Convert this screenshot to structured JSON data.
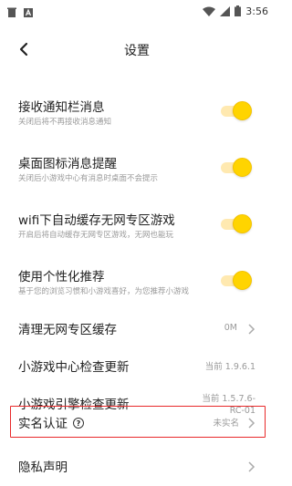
{
  "status_bar": {
    "time": "3:56",
    "left_icons": [
      "notification-trash-icon",
      "app-a-icon"
    ],
    "right_icons": [
      "wifi-icon",
      "signal-icon",
      "battery-icon"
    ]
  },
  "header": {
    "title": "设置",
    "back_icon": "chevron-left-icon"
  },
  "accent_color": "#ffd400",
  "highlight_color": "#e8292a",
  "settings": {
    "notification": {
      "title": "接收通知栏消息",
      "desc": "关闭后将不再接收消息通知",
      "enabled": true
    },
    "desktop_badge": {
      "title": "桌面图标消息提醒",
      "desc": "关闭后小游戏中心有消息时桌面不会提示",
      "enabled": true
    },
    "wifi_cache": {
      "title": "wifi下自动缓存无网专区游戏",
      "desc": "开启后将自动缓存无网专区游戏，无网也能玩",
      "enabled": true
    },
    "personalized": {
      "title": "使用个性化推荐",
      "desc": "基于您的浏览习惯和小游戏喜好，为您推荐小游戏",
      "enabled": true
    },
    "clear_cache": {
      "title": "清理无网专区缓存",
      "value": "0M"
    },
    "center_update": {
      "title": "小游戏中心检查更新",
      "value": "当前 1.9.6.1"
    },
    "engine_update": {
      "title": "小游戏引擎检查更新",
      "value_line1": "当前 1.5.7.6-",
      "value_line2": "RC-01"
    },
    "realname": {
      "title": "实名认证",
      "help_glyph": "?",
      "value": "未实名"
    },
    "privacy": {
      "title": "隐私声明"
    }
  }
}
